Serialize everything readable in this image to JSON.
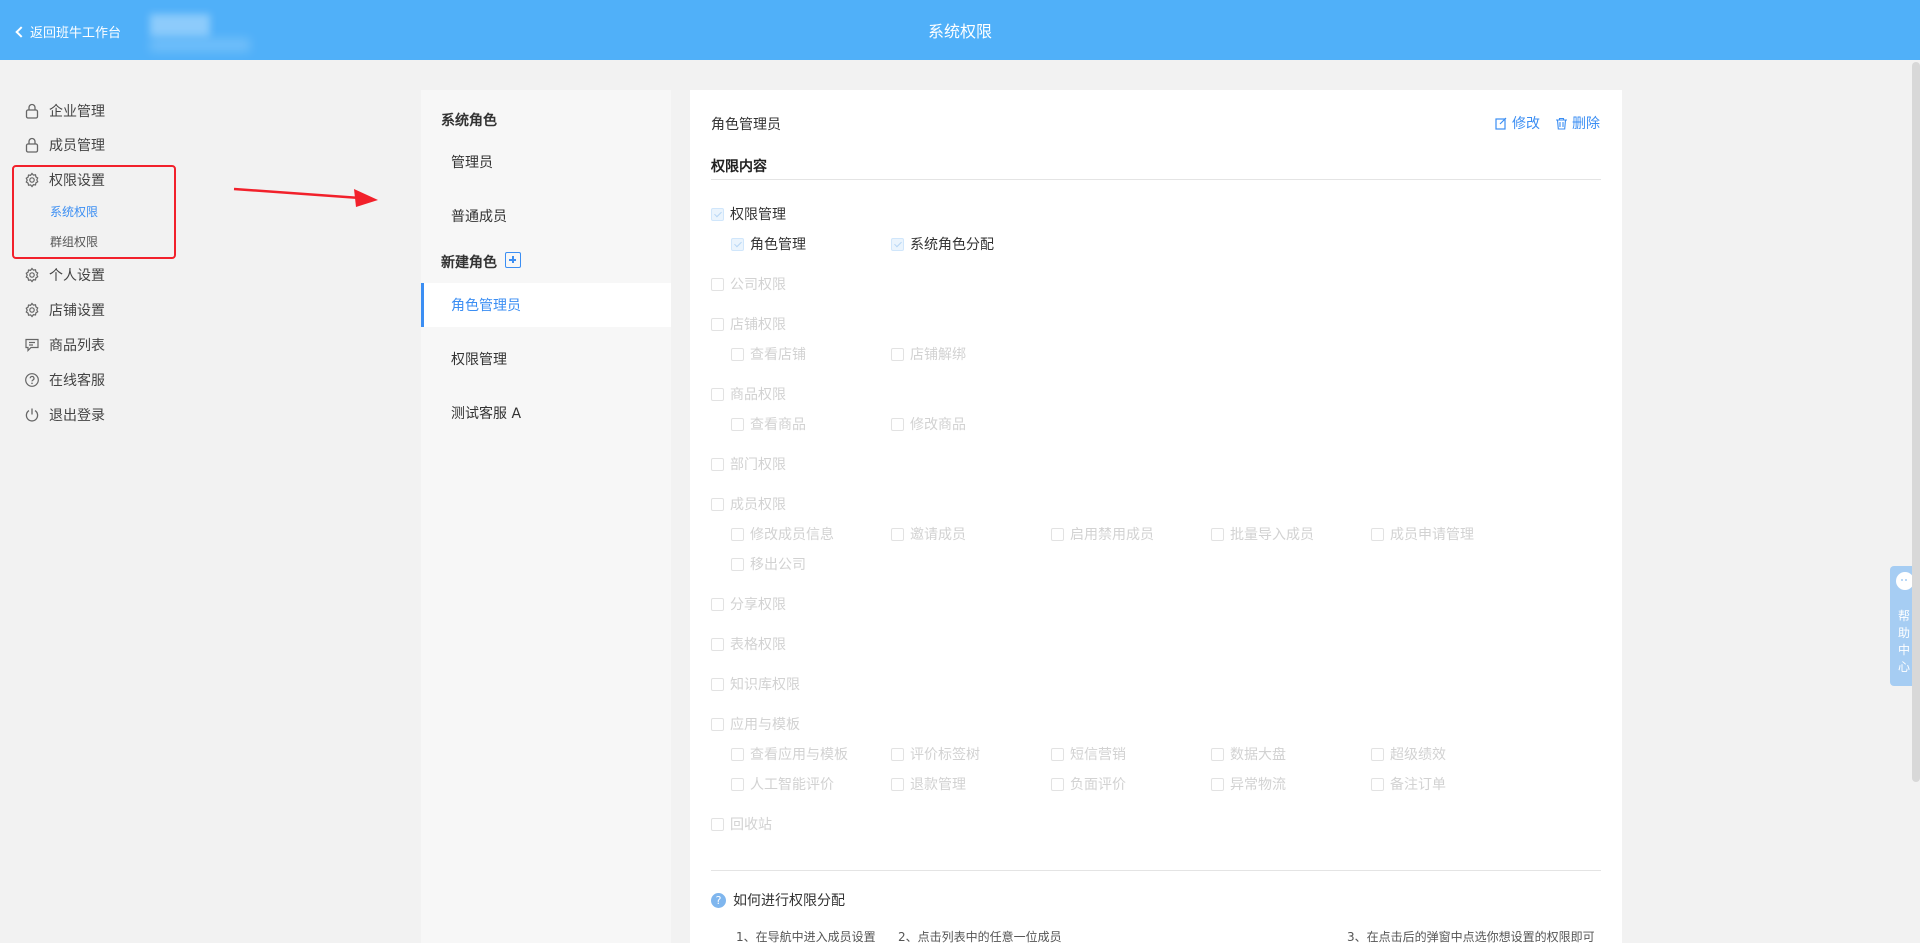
{
  "header": {
    "back_label": "返回班牛工作台",
    "title": "系统权限"
  },
  "sidebar": {
    "items": [
      {
        "label": "企业管理",
        "icon": "lock-icon"
      },
      {
        "label": "成员管理",
        "icon": "lock-icon"
      },
      {
        "label": "权限设置",
        "icon": "gear-icon"
      },
      {
        "label": "个人设置",
        "icon": "gear-icon"
      },
      {
        "label": "店铺设置",
        "icon": "gear-icon"
      },
      {
        "label": "商品列表",
        "icon": "list-icon"
      },
      {
        "label": "在线客服",
        "icon": "question-icon"
      },
      {
        "label": "退出登录",
        "icon": "power-icon"
      }
    ],
    "sub_items": [
      {
        "label": "系统权限",
        "active": true
      },
      {
        "label": "群组权限",
        "active": false
      }
    ]
  },
  "roles": {
    "system_title": "系统角色",
    "system_roles": [
      "管理员",
      "普通成员"
    ],
    "custom_title": "新建角色",
    "custom_roles": [
      "角色管理员",
      "权限管理",
      "测试客服 A"
    ],
    "selected": "角色管理员"
  },
  "main": {
    "role_name": "角色管理员",
    "edit_label": "修改",
    "delete_label": "删除",
    "section_title": "权限内容",
    "groups": [
      {
        "label": "权限管理",
        "checked": true,
        "children": [
          {
            "label": "角色管理",
            "checked": true
          },
          {
            "label": "系统角色分配",
            "checked": true
          }
        ]
      },
      {
        "label": "公司权限",
        "checked": false,
        "children": []
      },
      {
        "label": "店铺权限",
        "checked": false,
        "children": [
          {
            "label": "查看店铺",
            "checked": false
          },
          {
            "label": "店铺解绑",
            "checked": false
          }
        ]
      },
      {
        "label": "商品权限",
        "checked": false,
        "children": [
          {
            "label": "查看商品",
            "checked": false
          },
          {
            "label": "修改商品",
            "checked": false
          }
        ]
      },
      {
        "label": "部门权限",
        "checked": false,
        "children": []
      },
      {
        "label": "成员权限",
        "checked": false,
        "children": [
          {
            "label": "修改成员信息",
            "checked": false
          },
          {
            "label": "邀请成员",
            "checked": false
          },
          {
            "label": "启用禁用成员",
            "checked": false
          },
          {
            "label": "批量导入成员",
            "checked": false
          },
          {
            "label": "成员申请管理",
            "checked": false
          },
          {
            "label": "移出公司",
            "checked": false
          }
        ]
      },
      {
        "label": "分享权限",
        "checked": false,
        "children": []
      },
      {
        "label": "表格权限",
        "checked": false,
        "children": []
      },
      {
        "label": "知识库权限",
        "checked": false,
        "children": []
      },
      {
        "label": "应用与模板",
        "checked": false,
        "children": [
          {
            "label": "查看应用与模板",
            "checked": false
          },
          {
            "label": "评价标签树",
            "checked": false
          },
          {
            "label": "短信营销",
            "checked": false
          },
          {
            "label": "数据大盘",
            "checked": false
          },
          {
            "label": "超级绩效",
            "checked": false
          },
          {
            "label": "人工智能评价",
            "checked": false
          },
          {
            "label": "退款管理",
            "checked": false
          },
          {
            "label": "负面评价",
            "checked": false
          },
          {
            "label": "异常物流",
            "checked": false
          },
          {
            "label": "备注订单",
            "checked": false
          }
        ]
      },
      {
        "label": "回收站",
        "checked": false,
        "children": []
      }
    ],
    "help_title": "如何进行权限分配",
    "help_steps": [
      "1、在导航中进入成员设置",
      "2、点击列表中的任意一位成员",
      "3、在点击后的弹窗中点选你想设置的权限即可"
    ]
  },
  "help_center": {
    "label": "帮助中心"
  },
  "colors": {
    "header": "#50b0f9",
    "accent": "#3b8ef3",
    "annotation_red": "#f2212b"
  }
}
